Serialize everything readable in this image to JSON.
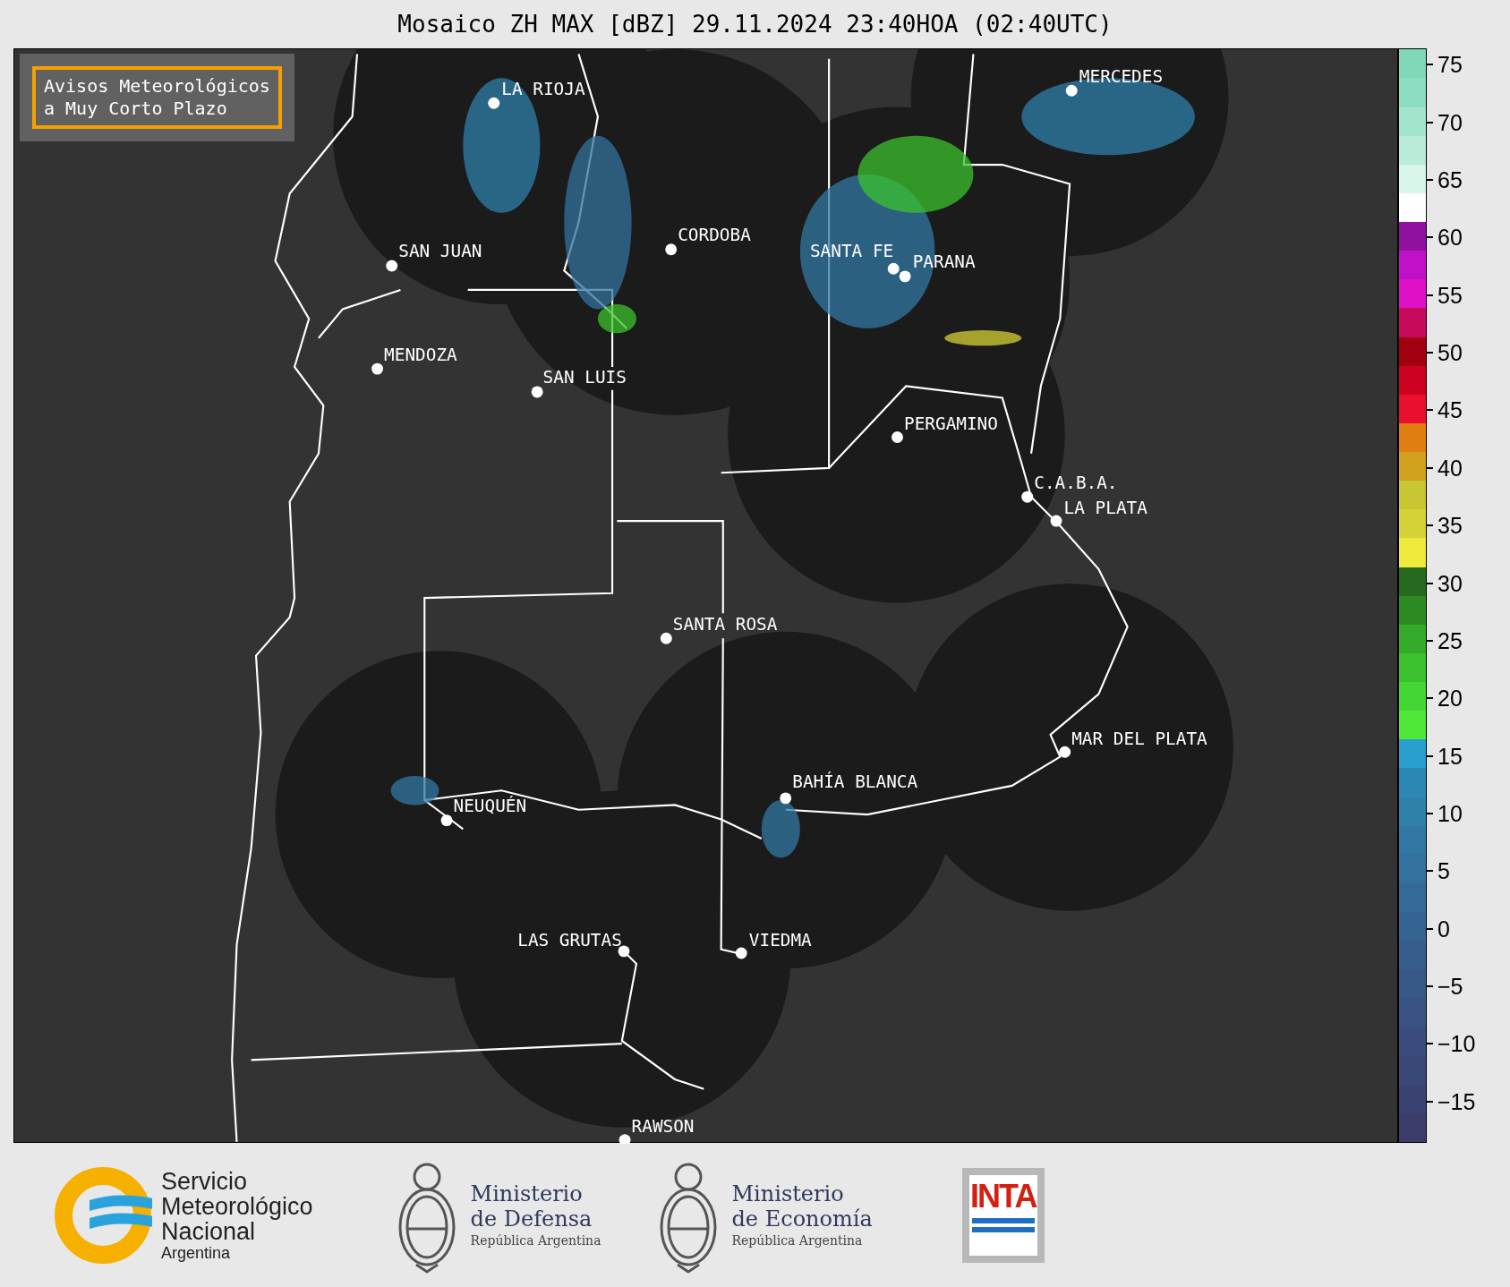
{
  "title": "Mosaico ZH MAX [dBZ] 29.11.2024 23:40HOA (02:40UTC)",
  "notice": [
    "Avisos Meteorológicos",
    "a Muy Corto Plazo"
  ],
  "cities": [
    {
      "name": "LA RIOJA"
    },
    {
      "name": "SAN JUAN"
    },
    {
      "name": "CORDOBA"
    },
    {
      "name": "SANTA FE"
    },
    {
      "name": "PARANA"
    },
    {
      "name": "MENDOZA"
    },
    {
      "name": "SAN LUIS"
    },
    {
      "name": "MERCEDES"
    },
    {
      "name": "PERGAMINO"
    },
    {
      "name": "C.A.B.A."
    },
    {
      "name": "LA PLATA"
    },
    {
      "name": "SANTA ROSA"
    },
    {
      "name": "MAR DEL PLATA"
    },
    {
      "name": "BAHÍA BLANCA"
    },
    {
      "name": "NEUQUÉN"
    },
    {
      "name": "LAS GRUTAS"
    },
    {
      "name": "VIEDMA"
    },
    {
      "name": "RAWSON"
    }
  ],
  "colorbar": {
    "segments": [
      {
        "color": "#3c3d6a"
      },
      {
        "color": "#3a4272"
      },
      {
        "color": "#3a4878"
      },
      {
        "color": "#3a4c7e"
      },
      {
        "color": "#395283"
      },
      {
        "color": "#385888"
      },
      {
        "color": "#375d8d"
      },
      {
        "color": "#366492"
      },
      {
        "color": "#356a98"
      },
      {
        "color": "#33719e"
      },
      {
        "color": "#3178a4"
      },
      {
        "color": "#2f80ab"
      },
      {
        "color": "#2c88b3"
      },
      {
        "color": "#28a0cf"
      },
      {
        "color": "#50e838"
      },
      {
        "color": "#44d634"
      },
      {
        "color": "#3cc22e"
      },
      {
        "color": "#33aa28"
      },
      {
        "color": "#2b8a22"
      },
      {
        "color": "#266a20"
      },
      {
        "color": "#eeea3c"
      },
      {
        "color": "#d4d236"
      },
      {
        "color": "#c8c632"
      },
      {
        "color": "#d2a21e"
      },
      {
        "color": "#e07e12"
      },
      {
        "color": "#e8102e"
      },
      {
        "color": "#cc0020"
      },
      {
        "color": "#a00010"
      },
      {
        "color": "#c80a5a"
      },
      {
        "color": "#e010c8"
      },
      {
        "color": "#c010c8"
      },
      {
        "color": "#9010a0"
      },
      {
        "color": "#ffffff"
      },
      {
        "color": "#d8f5ea"
      },
      {
        "color": "#b8ecd8"
      },
      {
        "color": "#a0e5cc"
      },
      {
        "color": "#8cddc2"
      },
      {
        "color": "#80d8b9"
      }
    ],
    "ticks": [
      "75",
      "70",
      "65",
      "60",
      "55",
      "50",
      "45",
      "40",
      "35",
      "30",
      "25",
      "20",
      "15",
      "10",
      "5",
      "0",
      "−5",
      "−10",
      "−15"
    ]
  },
  "logos": {
    "smn": [
      "Servicio",
      "Meteorológico",
      "Nacional",
      "Argentina"
    ],
    "defensa": [
      "Ministerio",
      "de Defensa",
      "República Argentina"
    ],
    "economia": [
      "Ministerio",
      "de Economía",
      "República Argentina"
    ],
    "inta": "INTA"
  }
}
